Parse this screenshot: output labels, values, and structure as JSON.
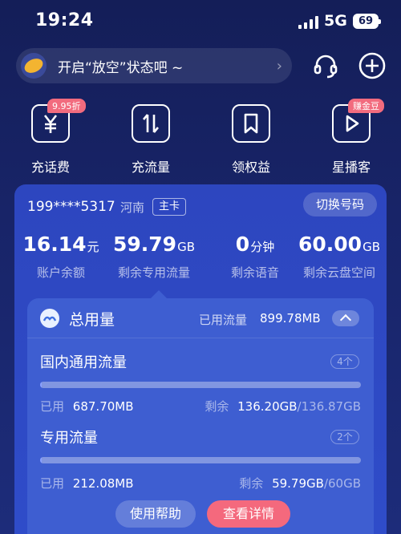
{
  "status_bar": {
    "time": "19:24",
    "network": "5G",
    "battery": "69"
  },
  "header": {
    "mood_text": "开启“放空”状态吧 ~",
    "icons": [
      "headset-icon",
      "plus-icon"
    ]
  },
  "quick_actions": [
    {
      "label": "充话费",
      "badge": "9.95折",
      "icon": "yuan-icon"
    },
    {
      "label": "充流量",
      "badge": "",
      "icon": "flow-arrows-icon"
    },
    {
      "label": "领权益",
      "badge": "",
      "icon": "bookmark-icon"
    },
    {
      "label": "星播客",
      "badge": "赚金豆",
      "icon": "play-icon"
    }
  ],
  "account": {
    "phone": "199****5317",
    "region": "河南",
    "card_tag": "主卡",
    "switch_label": "切换号码"
  },
  "stats": [
    {
      "value": "16.14",
      "unit": "元",
      "label": "账户余额"
    },
    {
      "value": "59.79",
      "unit": "GB",
      "label": "剩余专用流量"
    },
    {
      "value": "0",
      "unit": "分钟",
      "label": "剩余语音"
    },
    {
      "value": "60.00",
      "unit": "GB",
      "label": "剩余云盘空间"
    }
  ],
  "usage": {
    "title": "总用量",
    "used_label": "已用流量",
    "used_value": "899.78MB",
    "sections": [
      {
        "title": "国内通用流量",
        "count": "4个",
        "used_label": "已用",
        "used": "687.70MB",
        "remain_label": "剩余",
        "remain": "136.20GB",
        "total": "/136.87GB",
        "used_fraction": 0.005
      },
      {
        "title": "专用流量",
        "count": "2个",
        "used_label": "已用",
        "used": "212.08MB",
        "remain_label": "剩余",
        "remain": "59.79GB",
        "total": "/60GB",
        "used_fraction": 0.0035
      }
    ]
  },
  "buttons": {
    "help": "使用帮助",
    "detail": "查看详情"
  }
}
